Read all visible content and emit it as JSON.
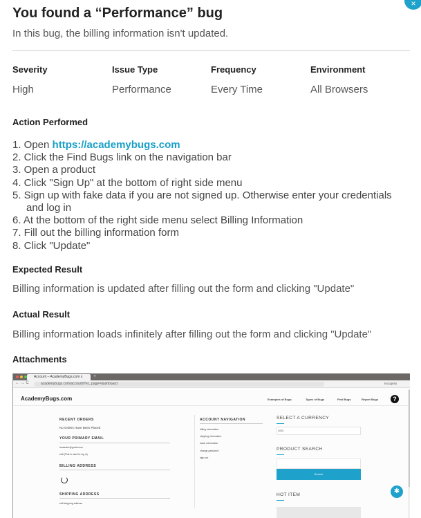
{
  "title": "You found a “Performance” bug",
  "subtitle": "In this bug, the billing information isn't updated.",
  "close_icon": "×",
  "meta": [
    {
      "label": "Severity",
      "value": "High"
    },
    {
      "label": "Issue Type",
      "value": "Performance"
    },
    {
      "label": "Frequency",
      "value": "Every Time"
    },
    {
      "label": "Environment",
      "value": "All Browsers"
    }
  ],
  "action_heading": "Action Performed",
  "steps": [
    {
      "prefix": "1. Open ",
      "link": "https://academybugs.com"
    },
    {
      "text": "2. Click the Find Bugs link on the navigation bar"
    },
    {
      "text": "3. Open a product"
    },
    {
      "text": "4. Click \"Sign Up\" at the bottom of right side menu"
    },
    {
      "text": "5. Sign up with fake data if you are not signed up. Otherwise enter your credentials and log in"
    },
    {
      "text": "6. At the bottom of the right side menu select Billing Information"
    },
    {
      "text": "7. Fill out the billing information form"
    },
    {
      "text": "8. Click \"Update\""
    }
  ],
  "expected_heading": "Expected Result",
  "expected": "Billing information is updated after filling out the form and clicking \"Update\"",
  "actual_heading": "Actual Result",
  "actual": "Billing information loads infinitely after filling out the form and clicking \"Update\"",
  "attachments_heading": "Attachments",
  "shot": {
    "tab": "Account – AcademyBugs.com",
    "tab_close": "x",
    "new_tab": "+",
    "url": "academybugs.com/account/?ec_page=dashboard",
    "incognito": "Incognito",
    "logo": "AcademyBugs.com",
    "nav": [
      "Examples of Bugs",
      "Types of Bugs",
      "Find Bugs",
      "Report Bugs"
    ],
    "help": "?",
    "recent_orders": "RECENT ORDERS",
    "no_orders": "No Orders Have Been Placed",
    "primary_email": "YOUR PRIMARY EMAIL",
    "email": "iamtester@gmail.com",
    "email_edit": "edit (This is used to log in)",
    "billing": "BILLING ADDRESS",
    "shipping": "SHIPPING ADDRESS",
    "shipping_edit": "edit shipping address",
    "account_nav": "ACCOUNT NAVIGATION",
    "account_items": [
      "billing information",
      "shipping information",
      "basic information",
      "change password",
      "sign out"
    ],
    "currency": "SELECT A CURRENCY",
    "currency_value": "USD",
    "product_search": "PRODUCT SEARCH",
    "search_btn": "Search",
    "hot_item": "HOT ITEM"
  }
}
